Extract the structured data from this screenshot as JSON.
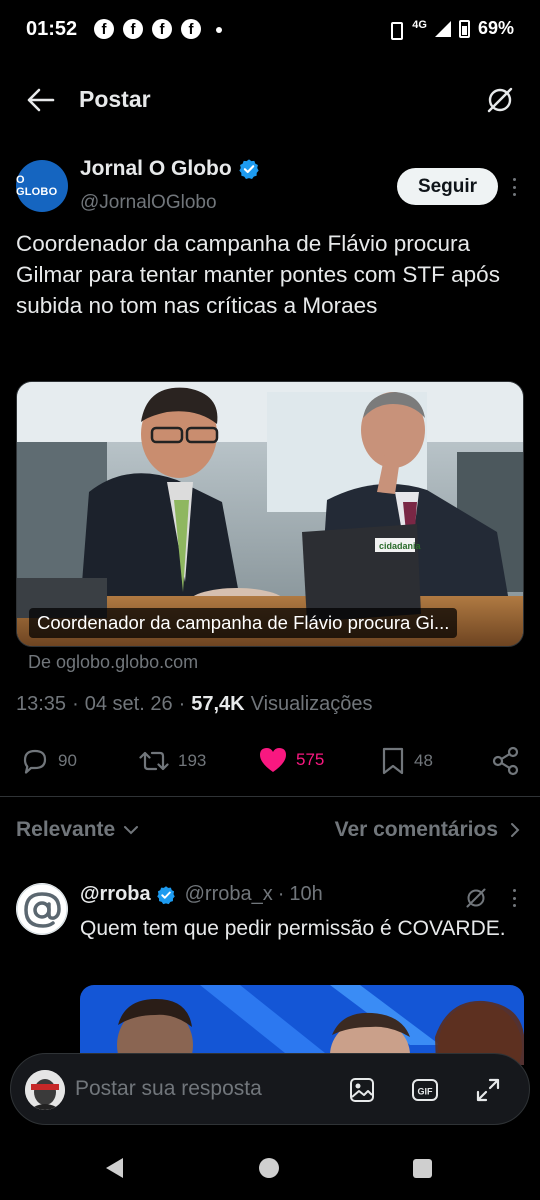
{
  "status_bar": {
    "time": "01:52",
    "notification_icons": [
      "f",
      "f",
      "f",
      "f"
    ],
    "network": "4G",
    "battery": "69%"
  },
  "header": {
    "title": "Postar"
  },
  "post": {
    "author_name": "Jornal O Globo",
    "author_handle": "@JornalOGlobo",
    "avatar_text": "O GLOBO",
    "follow_label": "Seguir",
    "text": "Coordenador da campanha de Flávio procura Gilmar para tentar manter pontes com STF após subida no tom nas críticas a Moraes",
    "media_caption": "Coordenador da campanha de Flávio procura Gi...",
    "media_sign": "cidadania",
    "source": "De oglobo.globo.com",
    "time": "13:35",
    "date": "04 set. 26",
    "views_count": "57,4K",
    "views_label": "Visualizações",
    "replies": "90",
    "reposts": "193",
    "likes": "575",
    "bookmarks": "48"
  },
  "sort": {
    "left_label": "Relevante",
    "right_label": "Ver comentários"
  },
  "reply": {
    "name": "@rroba",
    "handle": "@rroba_x",
    "time": "10h",
    "text": "Quem tem que pedir permissão é COVARDE."
  },
  "composer": {
    "placeholder": "Postar sua resposta",
    "gif_label": "GIF"
  },
  "colors": {
    "background": "#000000",
    "text": "#e7e9ea",
    "muted": "#71767b",
    "verified": "#1d9bf0",
    "like": "#f91880",
    "globo_blue": "#1565c0"
  }
}
